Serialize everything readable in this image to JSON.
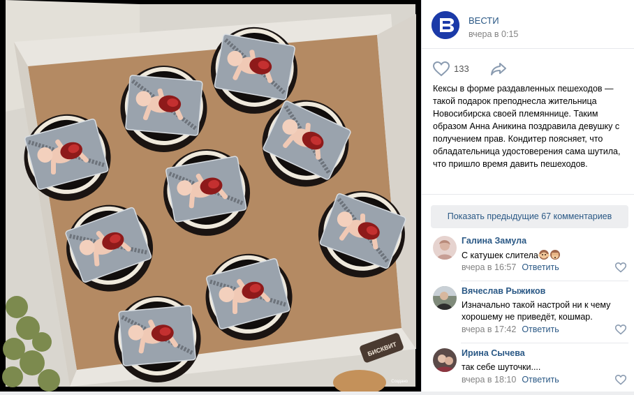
{
  "post": {
    "author": "ВЕСТИ",
    "time": "вчера в 0:15",
    "likes_count": "133",
    "text": "Кексы в форме раздавленных пешеходов — такой подарок преподнесла жительница Новосибирска своей племяннице. Таким образом Анна Аникина поздравила девушку с получением прав. Кондитер поясняет, что обладательница удостоверения сама шутила, что пришло время давить пешеходов.",
    "photo_watermark": "Создано"
  },
  "show_previous": "Показать предыдущие 67 комментариев",
  "comments": [
    {
      "author": "Галина Замула",
      "text": "С катушек слитела",
      "emojis": [
        "hear-no-evil-monkey-icon",
        "see-no-evil-monkey-icon"
      ],
      "time": "вчера в 16:57",
      "reply": "Ответить"
    },
    {
      "author": "Вячеслав Рыжиков",
      "text": "Изначально такой настрой ни к чему хорошему не приведёт, кошмар.",
      "time": "вчера в 17:42",
      "reply": "Ответить"
    },
    {
      "author": "Ирина Сычева",
      "text": "так себе шуточки....",
      "time": "вчера в 18:10",
      "reply": "Ответить"
    }
  ],
  "icons": {
    "logo": "vesti-logo",
    "like": "heart-icon",
    "share": "share-arrow-icon"
  },
  "colors": {
    "link": "#2a5885",
    "meta": "#828282",
    "logo_bg": "#1b3aa8",
    "panel_bg": "#ffffff",
    "button_bg": "#edeef0"
  }
}
